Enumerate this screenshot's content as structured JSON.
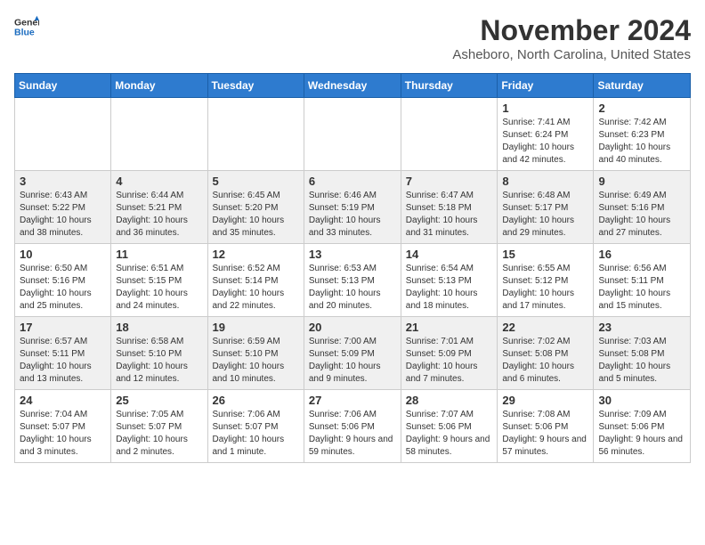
{
  "header": {
    "logo_line1": "General",
    "logo_line2": "Blue",
    "month": "November 2024",
    "location": "Asheboro, North Carolina, United States"
  },
  "weekdays": [
    "Sunday",
    "Monday",
    "Tuesday",
    "Wednesday",
    "Thursday",
    "Friday",
    "Saturday"
  ],
  "weeks": [
    [
      {
        "day": "",
        "info": ""
      },
      {
        "day": "",
        "info": ""
      },
      {
        "day": "",
        "info": ""
      },
      {
        "day": "",
        "info": ""
      },
      {
        "day": "",
        "info": ""
      },
      {
        "day": "1",
        "info": "Sunrise: 7:41 AM\nSunset: 6:24 PM\nDaylight: 10 hours and 42 minutes."
      },
      {
        "day": "2",
        "info": "Sunrise: 7:42 AM\nSunset: 6:23 PM\nDaylight: 10 hours and 40 minutes."
      }
    ],
    [
      {
        "day": "3",
        "info": "Sunrise: 6:43 AM\nSunset: 5:22 PM\nDaylight: 10 hours and 38 minutes."
      },
      {
        "day": "4",
        "info": "Sunrise: 6:44 AM\nSunset: 5:21 PM\nDaylight: 10 hours and 36 minutes."
      },
      {
        "day": "5",
        "info": "Sunrise: 6:45 AM\nSunset: 5:20 PM\nDaylight: 10 hours and 35 minutes."
      },
      {
        "day": "6",
        "info": "Sunrise: 6:46 AM\nSunset: 5:19 PM\nDaylight: 10 hours and 33 minutes."
      },
      {
        "day": "7",
        "info": "Sunrise: 6:47 AM\nSunset: 5:18 PM\nDaylight: 10 hours and 31 minutes."
      },
      {
        "day": "8",
        "info": "Sunrise: 6:48 AM\nSunset: 5:17 PM\nDaylight: 10 hours and 29 minutes."
      },
      {
        "day": "9",
        "info": "Sunrise: 6:49 AM\nSunset: 5:16 PM\nDaylight: 10 hours and 27 minutes."
      }
    ],
    [
      {
        "day": "10",
        "info": "Sunrise: 6:50 AM\nSunset: 5:16 PM\nDaylight: 10 hours and 25 minutes."
      },
      {
        "day": "11",
        "info": "Sunrise: 6:51 AM\nSunset: 5:15 PM\nDaylight: 10 hours and 24 minutes."
      },
      {
        "day": "12",
        "info": "Sunrise: 6:52 AM\nSunset: 5:14 PM\nDaylight: 10 hours and 22 minutes."
      },
      {
        "day": "13",
        "info": "Sunrise: 6:53 AM\nSunset: 5:13 PM\nDaylight: 10 hours and 20 minutes."
      },
      {
        "day": "14",
        "info": "Sunrise: 6:54 AM\nSunset: 5:13 PM\nDaylight: 10 hours and 18 minutes."
      },
      {
        "day": "15",
        "info": "Sunrise: 6:55 AM\nSunset: 5:12 PM\nDaylight: 10 hours and 17 minutes."
      },
      {
        "day": "16",
        "info": "Sunrise: 6:56 AM\nSunset: 5:11 PM\nDaylight: 10 hours and 15 minutes."
      }
    ],
    [
      {
        "day": "17",
        "info": "Sunrise: 6:57 AM\nSunset: 5:11 PM\nDaylight: 10 hours and 13 minutes."
      },
      {
        "day": "18",
        "info": "Sunrise: 6:58 AM\nSunset: 5:10 PM\nDaylight: 10 hours and 12 minutes."
      },
      {
        "day": "19",
        "info": "Sunrise: 6:59 AM\nSunset: 5:10 PM\nDaylight: 10 hours and 10 minutes."
      },
      {
        "day": "20",
        "info": "Sunrise: 7:00 AM\nSunset: 5:09 PM\nDaylight: 10 hours and 9 minutes."
      },
      {
        "day": "21",
        "info": "Sunrise: 7:01 AM\nSunset: 5:09 PM\nDaylight: 10 hours and 7 minutes."
      },
      {
        "day": "22",
        "info": "Sunrise: 7:02 AM\nSunset: 5:08 PM\nDaylight: 10 hours and 6 minutes."
      },
      {
        "day": "23",
        "info": "Sunrise: 7:03 AM\nSunset: 5:08 PM\nDaylight: 10 hours and 5 minutes."
      }
    ],
    [
      {
        "day": "24",
        "info": "Sunrise: 7:04 AM\nSunset: 5:07 PM\nDaylight: 10 hours and 3 minutes."
      },
      {
        "day": "25",
        "info": "Sunrise: 7:05 AM\nSunset: 5:07 PM\nDaylight: 10 hours and 2 minutes."
      },
      {
        "day": "26",
        "info": "Sunrise: 7:06 AM\nSunset: 5:07 PM\nDaylight: 10 hours and 1 minute."
      },
      {
        "day": "27",
        "info": "Sunrise: 7:06 AM\nSunset: 5:06 PM\nDaylight: 9 hours and 59 minutes."
      },
      {
        "day": "28",
        "info": "Sunrise: 7:07 AM\nSunset: 5:06 PM\nDaylight: 9 hours and 58 minutes."
      },
      {
        "day": "29",
        "info": "Sunrise: 7:08 AM\nSunset: 5:06 PM\nDaylight: 9 hours and 57 minutes."
      },
      {
        "day": "30",
        "info": "Sunrise: 7:09 AM\nSunset: 5:06 PM\nDaylight: 9 hours and 56 minutes."
      }
    ]
  ]
}
